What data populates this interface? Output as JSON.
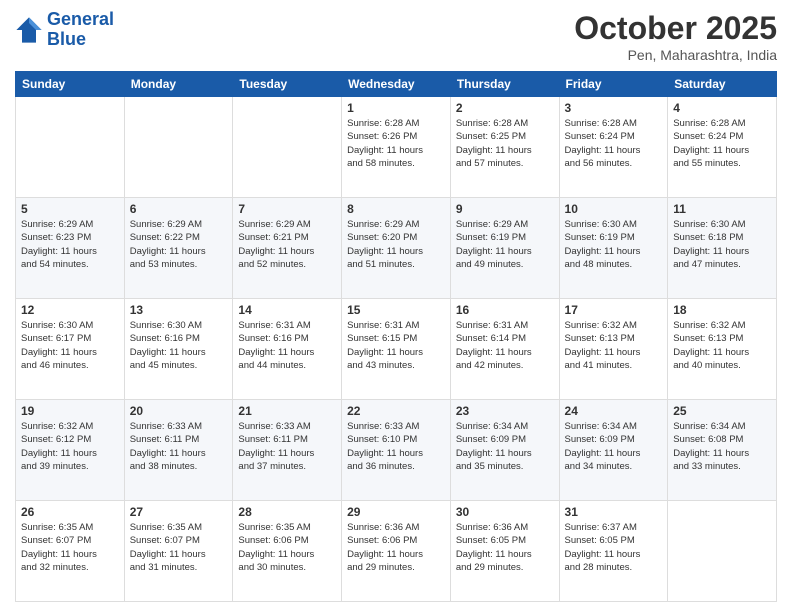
{
  "header": {
    "logo_line1": "General",
    "logo_line2": "Blue",
    "month": "October 2025",
    "location": "Pen, Maharashtra, India"
  },
  "weekdays": [
    "Sunday",
    "Monday",
    "Tuesday",
    "Wednesday",
    "Thursday",
    "Friday",
    "Saturday"
  ],
  "weeks": [
    [
      {
        "day": "",
        "info": ""
      },
      {
        "day": "",
        "info": ""
      },
      {
        "day": "",
        "info": ""
      },
      {
        "day": "1",
        "info": "Sunrise: 6:28 AM\nSunset: 6:26 PM\nDaylight: 11 hours\nand 58 minutes."
      },
      {
        "day": "2",
        "info": "Sunrise: 6:28 AM\nSunset: 6:25 PM\nDaylight: 11 hours\nand 57 minutes."
      },
      {
        "day": "3",
        "info": "Sunrise: 6:28 AM\nSunset: 6:24 PM\nDaylight: 11 hours\nand 56 minutes."
      },
      {
        "day": "4",
        "info": "Sunrise: 6:28 AM\nSunset: 6:24 PM\nDaylight: 11 hours\nand 55 minutes."
      }
    ],
    [
      {
        "day": "5",
        "info": "Sunrise: 6:29 AM\nSunset: 6:23 PM\nDaylight: 11 hours\nand 54 minutes."
      },
      {
        "day": "6",
        "info": "Sunrise: 6:29 AM\nSunset: 6:22 PM\nDaylight: 11 hours\nand 53 minutes."
      },
      {
        "day": "7",
        "info": "Sunrise: 6:29 AM\nSunset: 6:21 PM\nDaylight: 11 hours\nand 52 minutes."
      },
      {
        "day": "8",
        "info": "Sunrise: 6:29 AM\nSunset: 6:20 PM\nDaylight: 11 hours\nand 51 minutes."
      },
      {
        "day": "9",
        "info": "Sunrise: 6:29 AM\nSunset: 6:19 PM\nDaylight: 11 hours\nand 49 minutes."
      },
      {
        "day": "10",
        "info": "Sunrise: 6:30 AM\nSunset: 6:19 PM\nDaylight: 11 hours\nand 48 minutes."
      },
      {
        "day": "11",
        "info": "Sunrise: 6:30 AM\nSunset: 6:18 PM\nDaylight: 11 hours\nand 47 minutes."
      }
    ],
    [
      {
        "day": "12",
        "info": "Sunrise: 6:30 AM\nSunset: 6:17 PM\nDaylight: 11 hours\nand 46 minutes."
      },
      {
        "day": "13",
        "info": "Sunrise: 6:30 AM\nSunset: 6:16 PM\nDaylight: 11 hours\nand 45 minutes."
      },
      {
        "day": "14",
        "info": "Sunrise: 6:31 AM\nSunset: 6:16 PM\nDaylight: 11 hours\nand 44 minutes."
      },
      {
        "day": "15",
        "info": "Sunrise: 6:31 AM\nSunset: 6:15 PM\nDaylight: 11 hours\nand 43 minutes."
      },
      {
        "day": "16",
        "info": "Sunrise: 6:31 AM\nSunset: 6:14 PM\nDaylight: 11 hours\nand 42 minutes."
      },
      {
        "day": "17",
        "info": "Sunrise: 6:32 AM\nSunset: 6:13 PM\nDaylight: 11 hours\nand 41 minutes."
      },
      {
        "day": "18",
        "info": "Sunrise: 6:32 AM\nSunset: 6:13 PM\nDaylight: 11 hours\nand 40 minutes."
      }
    ],
    [
      {
        "day": "19",
        "info": "Sunrise: 6:32 AM\nSunset: 6:12 PM\nDaylight: 11 hours\nand 39 minutes."
      },
      {
        "day": "20",
        "info": "Sunrise: 6:33 AM\nSunset: 6:11 PM\nDaylight: 11 hours\nand 38 minutes."
      },
      {
        "day": "21",
        "info": "Sunrise: 6:33 AM\nSunset: 6:11 PM\nDaylight: 11 hours\nand 37 minutes."
      },
      {
        "day": "22",
        "info": "Sunrise: 6:33 AM\nSunset: 6:10 PM\nDaylight: 11 hours\nand 36 minutes."
      },
      {
        "day": "23",
        "info": "Sunrise: 6:34 AM\nSunset: 6:09 PM\nDaylight: 11 hours\nand 35 minutes."
      },
      {
        "day": "24",
        "info": "Sunrise: 6:34 AM\nSunset: 6:09 PM\nDaylight: 11 hours\nand 34 minutes."
      },
      {
        "day": "25",
        "info": "Sunrise: 6:34 AM\nSunset: 6:08 PM\nDaylight: 11 hours\nand 33 minutes."
      }
    ],
    [
      {
        "day": "26",
        "info": "Sunrise: 6:35 AM\nSunset: 6:07 PM\nDaylight: 11 hours\nand 32 minutes."
      },
      {
        "day": "27",
        "info": "Sunrise: 6:35 AM\nSunset: 6:07 PM\nDaylight: 11 hours\nand 31 minutes."
      },
      {
        "day": "28",
        "info": "Sunrise: 6:35 AM\nSunset: 6:06 PM\nDaylight: 11 hours\nand 30 minutes."
      },
      {
        "day": "29",
        "info": "Sunrise: 6:36 AM\nSunset: 6:06 PM\nDaylight: 11 hours\nand 29 minutes."
      },
      {
        "day": "30",
        "info": "Sunrise: 6:36 AM\nSunset: 6:05 PM\nDaylight: 11 hours\nand 29 minutes."
      },
      {
        "day": "31",
        "info": "Sunrise: 6:37 AM\nSunset: 6:05 PM\nDaylight: 11 hours\nand 28 minutes."
      },
      {
        "day": "",
        "info": ""
      }
    ]
  ]
}
